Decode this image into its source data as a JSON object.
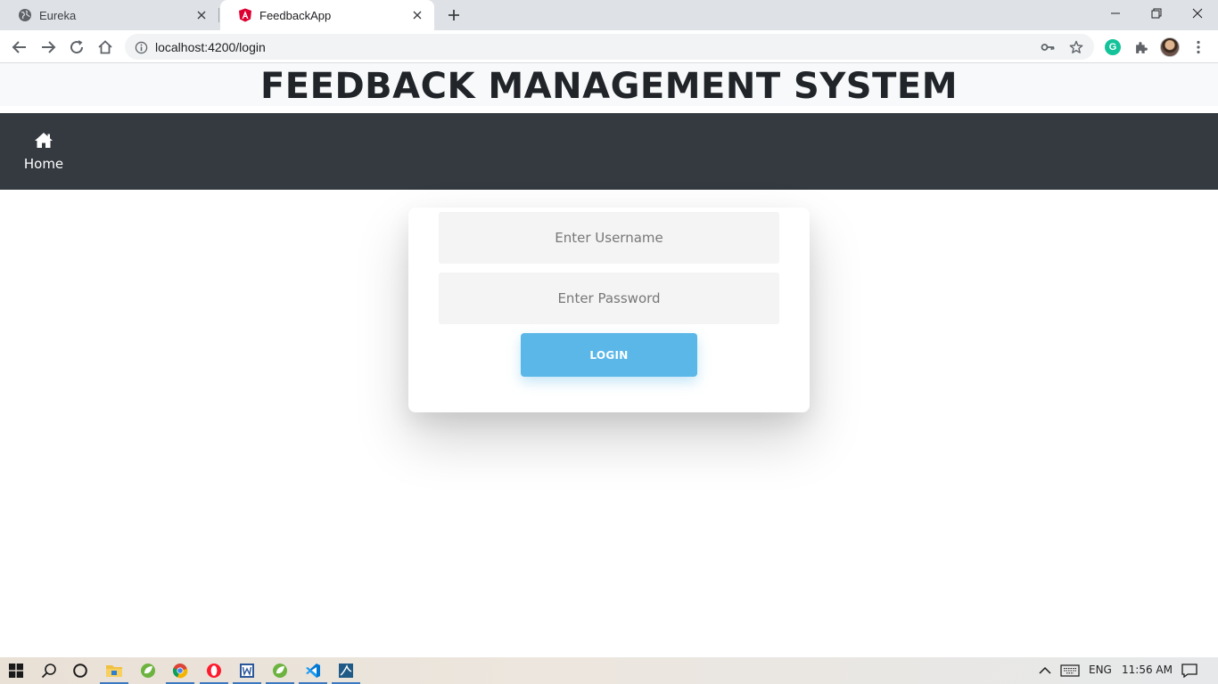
{
  "browser": {
    "tabs": [
      {
        "title": "Eureka",
        "favicon": "globe-icon",
        "active": false
      },
      {
        "title": "FeedbackApp",
        "favicon": "angular-icon",
        "active": true
      }
    ],
    "address_url": "localhost:4200/login"
  },
  "app": {
    "title": "FEEDBACK MANAGEMENT SYSTEM",
    "nav": {
      "home_label": "Home",
      "home_icon": "home-icon"
    },
    "login": {
      "username_placeholder": "Enter Username",
      "password_placeholder": "Enter Password",
      "username_value": "",
      "password_value": "",
      "button_label": "LOGIN"
    }
  },
  "taskbar": {
    "apps": [
      "windows-start-icon",
      "search-icon",
      "cortana-icon",
      "file-explorer-icon",
      "spring-tool-suite-icon",
      "chrome-icon",
      "opera-icon",
      "word-icon",
      "spring-tool-suite-icon",
      "vscode-icon",
      "mysql-workbench-icon"
    ],
    "language": "ENG",
    "time": "11:56 AM"
  },
  "colors": {
    "navbar_bg": "#343a40",
    "header_bg": "#f8f9fa",
    "login_button": "#5bb7e8",
    "input_bg": "#f4f4f4"
  }
}
